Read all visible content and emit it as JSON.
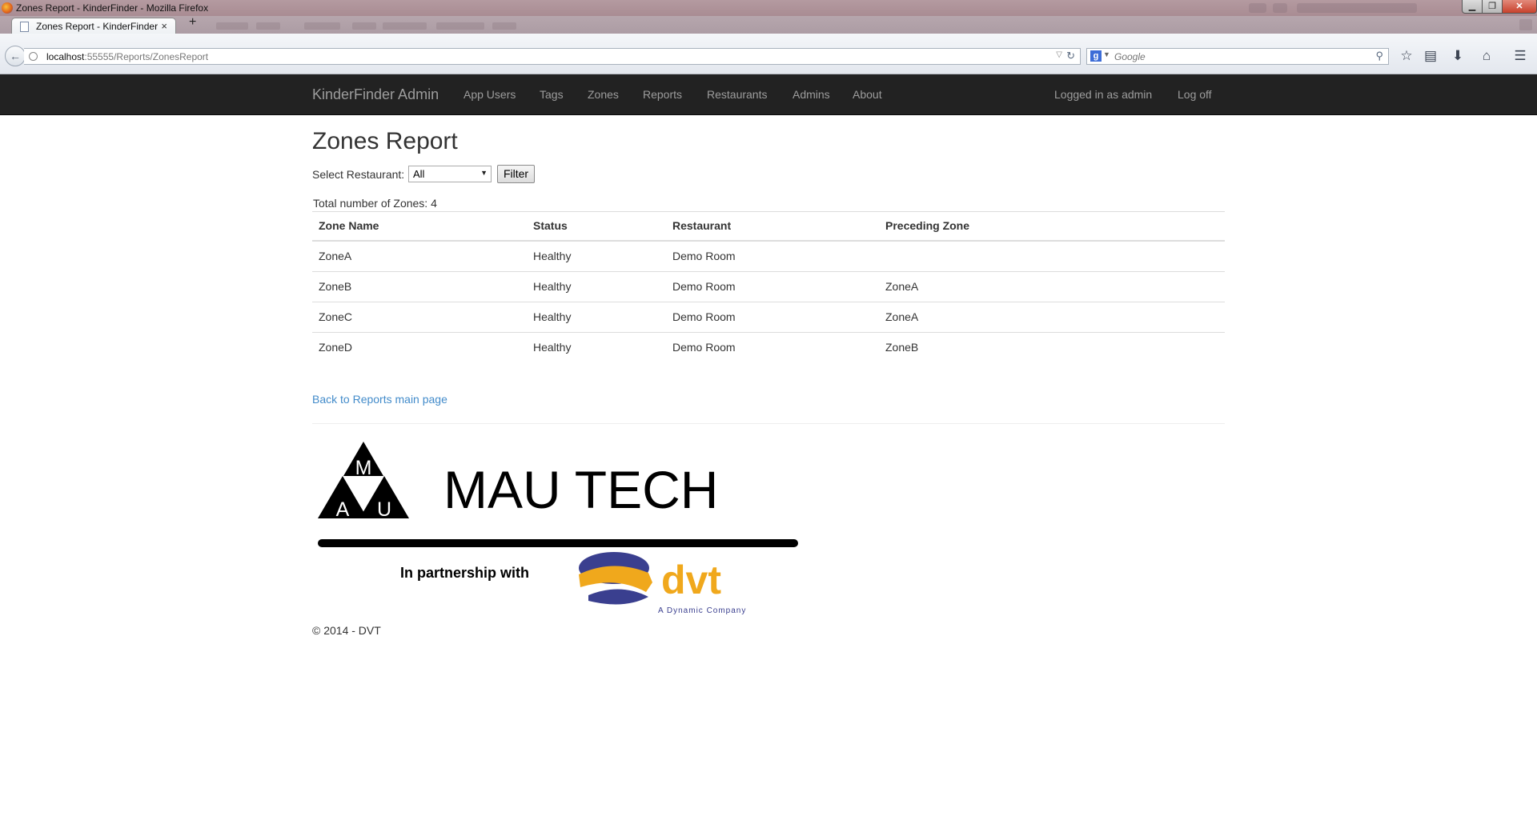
{
  "window": {
    "title": "Zones Report - KinderFinder - Mozilla Firefox",
    "buttons": {
      "minimize": "▁",
      "maximize": "❐",
      "close": "✕"
    }
  },
  "browser": {
    "tab_title": "Zones Report - KinderFinder",
    "tab_close": "×",
    "new_tab": "+",
    "url_host": "localhost",
    "url_rest": ":55555/Reports/ZonesReport",
    "search_placeholder": "Google",
    "icons": [
      "star-icon",
      "bookmarks-icon",
      "download-icon",
      "home-icon",
      "menu-icon"
    ]
  },
  "nav": {
    "brand": "KinderFinder Admin",
    "links": [
      "App Users",
      "Tags",
      "Zones",
      "Reports",
      "Restaurants",
      "Admins",
      "About"
    ],
    "right": [
      "Logged in as admin",
      "Log off"
    ]
  },
  "page": {
    "title": "Zones Report",
    "select_label": "Select Restaurant:",
    "select_value": "All",
    "filter_button": "Filter",
    "total": "Total number of Zones: 4",
    "back_link": "Back to Reports main page",
    "footer": "© 2014 - DVT"
  },
  "table": {
    "headers": [
      "Zone Name",
      "Status",
      "Restaurant",
      "Preceding Zone"
    ],
    "rows": [
      [
        "ZoneA",
        "Healthy",
        "Demo Room",
        ""
      ],
      [
        "ZoneB",
        "Healthy",
        "Demo Room",
        "ZoneA"
      ],
      [
        "ZoneC",
        "Healthy",
        "Demo Room",
        "ZoneA"
      ],
      [
        "ZoneD",
        "Healthy",
        "Demo Room",
        "ZoneB"
      ]
    ]
  },
  "logo": {
    "letters": [
      "M",
      "A",
      "U"
    ],
    "name": "MAU TECH",
    "partnership": "In partnership with",
    "dvt": "dvt",
    "dvt_tagline": "A Dynamic Company"
  },
  "colors": {
    "navbar_bg": "#222222",
    "nav_text": "#9d9d9d",
    "link": "#428bca",
    "dvt_orange": "#f0a81c",
    "dvt_blue": "#3a3f8f"
  }
}
